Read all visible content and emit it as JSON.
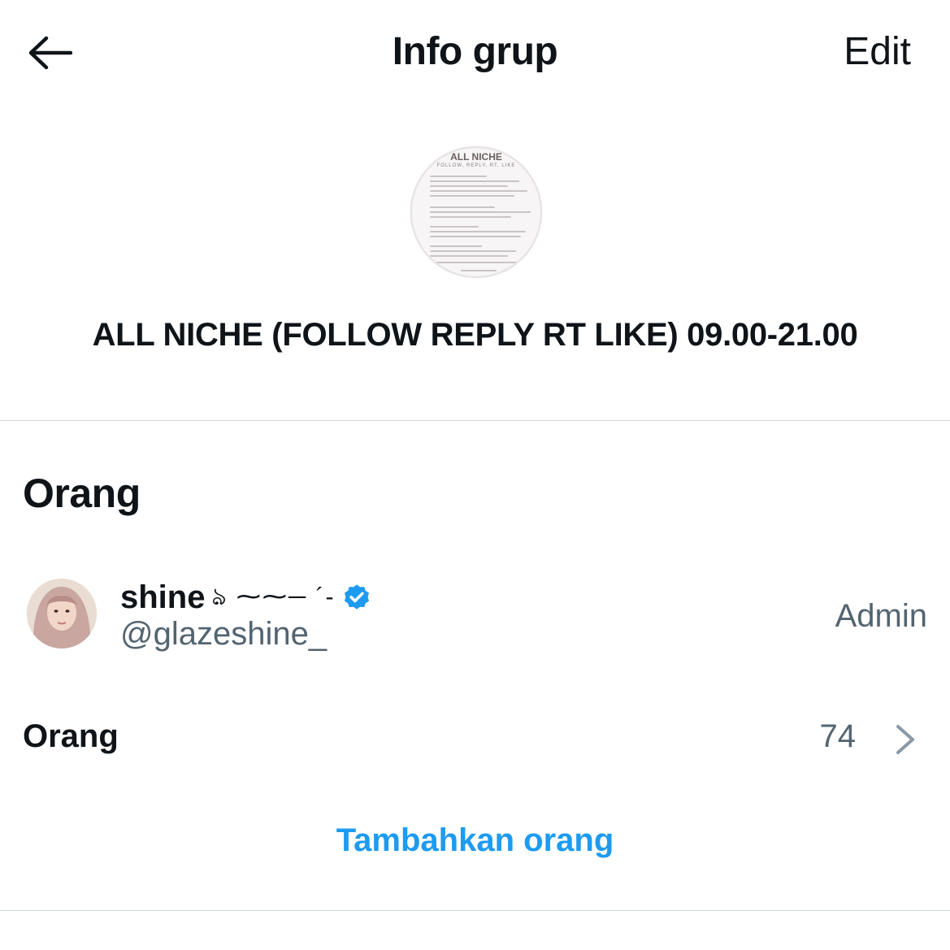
{
  "header": {
    "title": "Info grup",
    "edit_label": "Edit"
  },
  "group": {
    "avatar_title": "ALL NICHE",
    "avatar_subtitle": "FOLLOW, REPLY, RT, LIKE",
    "name": "ALL NICHE (FOLLOW REPLY RT LIKE) 09.00-21.00"
  },
  "people_section": {
    "title": "Orang",
    "members": [
      {
        "display_name": "shine",
        "name_decoration": "ঌ ⁓⁓─ ´-",
        "handle": "@glazeshine_",
        "role": "Admin",
        "verified": true
      }
    ],
    "count_label": "Orang",
    "count": "74",
    "add_label": "Tambahkan orang"
  },
  "icons": {
    "back": "arrow-left-icon",
    "verified": "verified-badge-icon",
    "chevron": "chevron-right-icon"
  },
  "colors": {
    "accent": "#1d9bf0",
    "text_primary": "#0f1419",
    "text_secondary": "#536471",
    "divider": "#cfd9de"
  }
}
